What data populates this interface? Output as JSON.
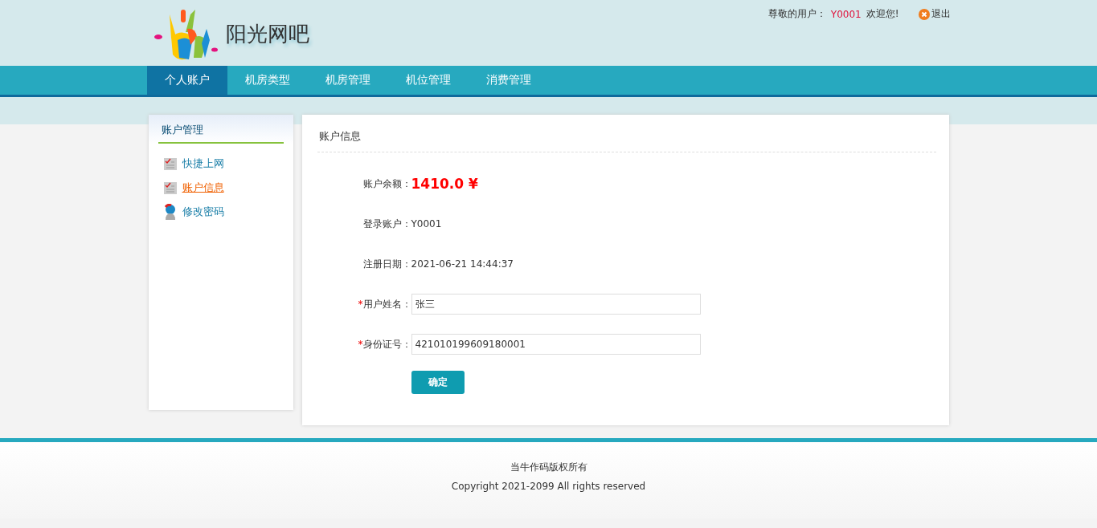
{
  "header": {
    "logo_text": "阳光网吧",
    "greeting": "尊敬的用户：",
    "username": "Y0001",
    "welcome": "欢迎您!",
    "logout": "退出"
  },
  "nav": [
    {
      "label": "个人账户",
      "selected": true
    },
    {
      "label": "机房类型",
      "selected": false
    },
    {
      "label": "机房管理",
      "selected": false
    },
    {
      "label": "机位管理",
      "selected": false
    },
    {
      "label": "消费管理",
      "selected": false
    }
  ],
  "sidebar": {
    "title": "账户管理",
    "items": [
      {
        "label": "快捷上网",
        "selected": false,
        "kind": "list"
      },
      {
        "label": "账户信息",
        "selected": true,
        "kind": "list"
      },
      {
        "label": "修改密码",
        "selected": false,
        "kind": "user"
      }
    ]
  },
  "panel": {
    "title": "账户信息",
    "fields": [
      {
        "kind": "amount",
        "label": "账户余额：",
        "value": "1410.0 ¥"
      },
      {
        "kind": "text",
        "label": "登录账户：",
        "value": "Y0001"
      },
      {
        "kind": "text",
        "label": "注册日期：",
        "value": "2021-06-21 14:44:37"
      },
      {
        "kind": "input",
        "mark": "*",
        "label": "用户姓名：",
        "value": "张三"
      },
      {
        "kind": "input",
        "mark": "*",
        "label": "身份证号：",
        "value": "421010199609180001"
      }
    ],
    "button": "确定"
  },
  "footer": {
    "lines": [
      "当牛作码版权所有",
      "Copyright 2021-2099 All rights reserved"
    ]
  }
}
